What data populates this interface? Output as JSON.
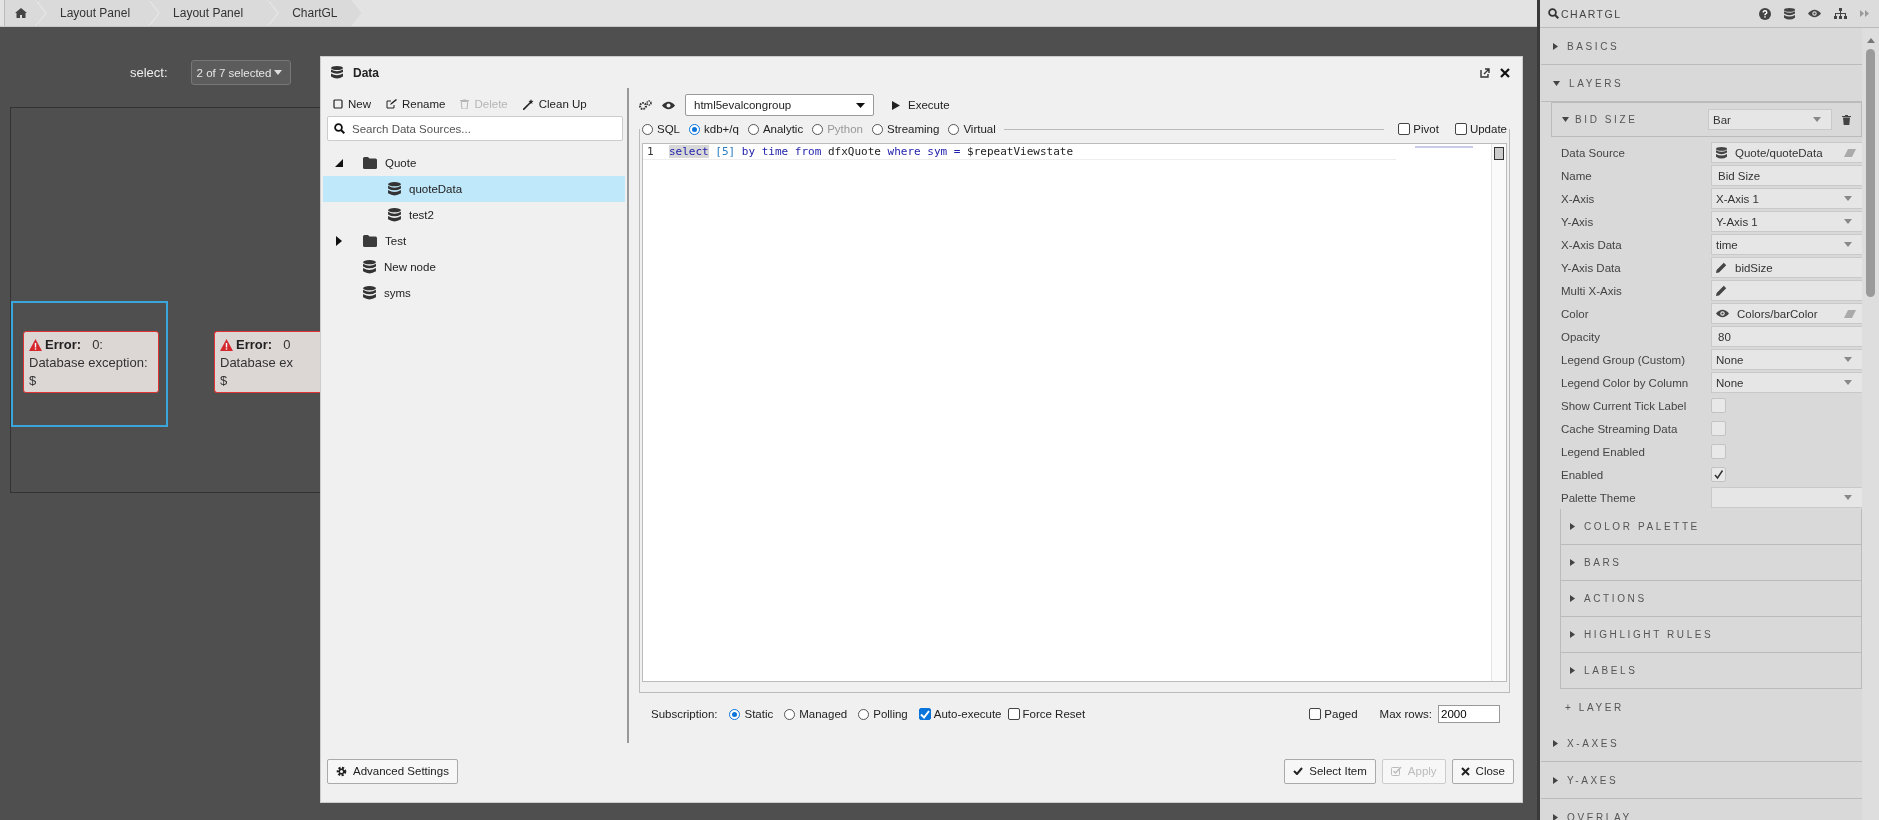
{
  "breadcrumb": [
    {
      "label": "Layout Panel"
    },
    {
      "label": "Layout Panel"
    },
    {
      "label": "ChartGL"
    }
  ],
  "canvas": {
    "select_label": "select:",
    "select_value": "2 of 7 selected",
    "widgets": [
      {
        "title": "Error:",
        "code": "0:",
        "message": "Database exception:",
        "detail": "$",
        "selected": true
      },
      {
        "title": "Error:",
        "code": "0",
        "message": "Database ex",
        "detail": "$",
        "selected": false
      }
    ]
  },
  "dialog": {
    "title": "Data",
    "toolbar": [
      {
        "label": "New",
        "kind": "new",
        "disabled": false
      },
      {
        "label": "Rename",
        "kind": "rename",
        "disabled": false
      },
      {
        "label": "Delete",
        "kind": "delete",
        "disabled": true
      },
      {
        "label": "Clean Up",
        "kind": "cleanup",
        "disabled": false
      }
    ],
    "search": {
      "placeholder": "Search Data Sources..."
    },
    "tree": [
      {
        "label": "Quote",
        "kind": "folder",
        "expanded": true,
        "selected": false,
        "children": [
          {
            "label": "quoteData",
            "kind": "source",
            "selected": true
          },
          {
            "label": "test2",
            "kind": "source",
            "selected": false
          }
        ]
      },
      {
        "label": "Test",
        "kind": "folder",
        "expanded": false,
        "selected": false
      },
      {
        "label": "New node",
        "kind": "source",
        "selected": false
      },
      {
        "label": "syms",
        "kind": "source",
        "selected": false
      }
    ],
    "connection": "html5evalcongroup",
    "execute": "Execute",
    "query_types": [
      {
        "label": "SQL",
        "selected": false,
        "disabled": false
      },
      {
        "label": "kdb+/q",
        "selected": true,
        "disabled": false
      },
      {
        "label": "Analytic",
        "selected": false,
        "disabled": false
      },
      {
        "label": "Python",
        "selected": false,
        "disabled": true
      },
      {
        "label": "Streaming",
        "selected": false,
        "disabled": false
      },
      {
        "label": "Virtual",
        "selected": false,
        "disabled": false
      }
    ],
    "options": [
      {
        "label": "Pivot",
        "checked": false
      },
      {
        "label": "Update",
        "checked": false
      }
    ],
    "editor": {
      "line": "1",
      "tokens": [
        {
          "text": "select",
          "kind": "keyword",
          "highlighted": true
        },
        {
          "text": " [5]",
          "kind": "number",
          "highlighted": false
        },
        {
          "text": " by time from",
          "kind": "keyword",
          "highlighted": false
        },
        {
          "text": " dfxQuote",
          "kind": "ident",
          "highlighted": false
        },
        {
          "text": " where sym =",
          "kind": "keyword",
          "highlighted": false
        },
        {
          "text": " $repeatViewstate",
          "kind": "ident",
          "highlighted": false
        }
      ]
    },
    "subscription": {
      "label": "Subscription:",
      "options": [
        {
          "label": "Static",
          "selected": true
        },
        {
          "label": "Managed",
          "selected": false
        },
        {
          "label": "Polling",
          "selected": false
        }
      ],
      "checks": [
        {
          "label": "Auto-execute",
          "checked": true
        },
        {
          "label": "Force Reset",
          "checked": false
        }
      ]
    },
    "paged": {
      "label": "Paged",
      "checked": false
    },
    "max_rows": {
      "label": "Max rows:",
      "value": "2000"
    },
    "buttons": [
      {
        "label": "Advanced Settings",
        "kind": "settings",
        "disabled": false
      },
      {
        "label": "Select Item",
        "kind": "select",
        "disabled": false
      },
      {
        "label": "Apply",
        "kind": "apply",
        "disabled": true
      },
      {
        "label": "Close",
        "kind": "close",
        "disabled": false
      }
    ]
  },
  "panel": {
    "title": "CHARTGL",
    "sections_top": [
      {
        "label": "BASICS",
        "expanded": false
      },
      {
        "label": "LAYERS",
        "expanded": true
      }
    ],
    "layer": {
      "name": "BID SIZE",
      "type": "Bar",
      "expanded": true
    },
    "properties": [
      {
        "label": "Data Source",
        "kind": "source-field",
        "value": "Quote/quoteData"
      },
      {
        "label": "Name",
        "kind": "text",
        "value": "Bid Size"
      },
      {
        "label": "X-Axis",
        "kind": "select",
        "value": "X-Axis 1"
      },
      {
        "label": "Y-Axis",
        "kind": "select",
        "value": "Y-Axis 1"
      },
      {
        "label": "X-Axis Data",
        "kind": "select",
        "value": "time"
      },
      {
        "label": "Y-Axis Data",
        "kind": "edit-field",
        "value": "bidSize"
      },
      {
        "label": "Multi X-Axis",
        "kind": "edit-field"
      },
      {
        "label": "Color",
        "kind": "binding-field",
        "value": "Colors/barColor"
      },
      {
        "label": "Opacity",
        "kind": "text",
        "value": "80"
      },
      {
        "label": "Legend Group (Custom)",
        "kind": "select",
        "value": "None"
      },
      {
        "label": "Legend Color by Column",
        "kind": "select",
        "value": "None"
      },
      {
        "label": "Show Current Tick Label",
        "kind": "checkbox",
        "checked": false
      },
      {
        "label": "Cache Streaming Data",
        "kind": "checkbox",
        "checked": false
      },
      {
        "label": "Legend Enabled",
        "kind": "checkbox",
        "checked": false
      },
      {
        "label": "Enabled",
        "kind": "checkbox",
        "checked": true
      },
      {
        "label": "Palette Theme",
        "kind": "select"
      }
    ],
    "subsections": [
      {
        "label": "COLOR PALETTE",
        "expanded": false
      },
      {
        "label": "BARS",
        "expanded": false
      },
      {
        "label": "ACTIONS",
        "expanded": false
      },
      {
        "label": "HIGHLIGHT RULES",
        "expanded": false
      },
      {
        "label": "LABELS",
        "expanded": false
      }
    ],
    "add_layer": "+ LAYER",
    "sections_bottom": [
      {
        "label": "X-AXES",
        "expanded": false
      },
      {
        "label": "Y-AXES",
        "expanded": false
      },
      {
        "label": "OVERLAY",
        "expanded": false
      }
    ]
  }
}
